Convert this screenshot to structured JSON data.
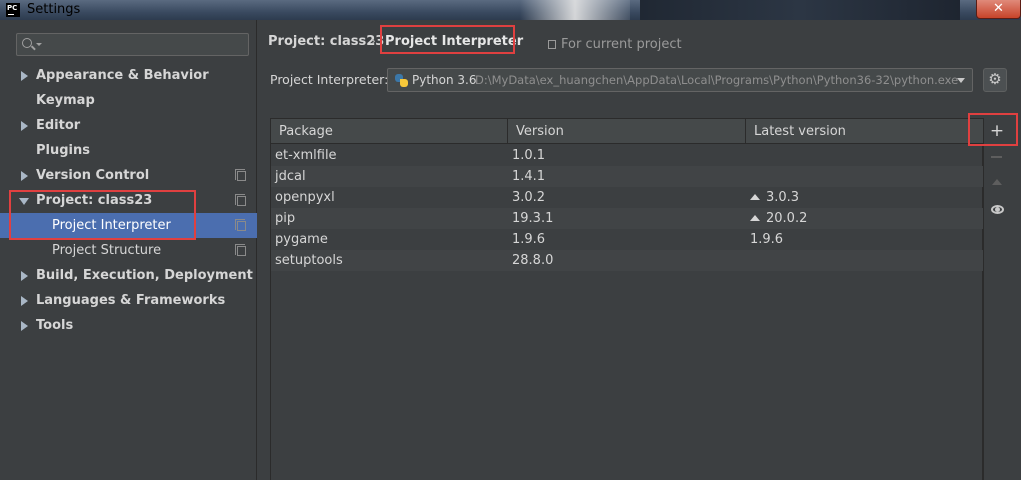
{
  "window": {
    "title": "Settings",
    "logo_text": "PC",
    "close_glyph": "✕"
  },
  "sidebar": {
    "search_placeholder": "",
    "items": [
      {
        "label": "Appearance & Behavior",
        "caret": "collapsed",
        "copy_icon": false
      },
      {
        "label": "Keymap",
        "caret": "none",
        "copy_icon": false
      },
      {
        "label": "Editor",
        "caret": "collapsed",
        "copy_icon": false
      },
      {
        "label": "Plugins",
        "caret": "none",
        "copy_icon": false
      },
      {
        "label": "Version Control",
        "caret": "collapsed",
        "copy_icon": true
      },
      {
        "label": "Project: class23",
        "caret": "expanded",
        "copy_icon": true
      },
      {
        "label": "Project Interpreter",
        "caret": "none",
        "copy_icon": true,
        "selected": true
      },
      {
        "label": "Project Structure",
        "caret": "none",
        "copy_icon": true
      },
      {
        "label": "Build, Execution, Deployment",
        "caret": "collapsed",
        "copy_icon": false
      },
      {
        "label": "Languages & Frameworks",
        "caret": "collapsed",
        "copy_icon": false
      },
      {
        "label": "Tools",
        "caret": "collapsed",
        "copy_icon": false
      }
    ]
  },
  "breadcrumb": {
    "project": "Project: class23",
    "separator": "›",
    "current": "Project Interpreter",
    "scope_note": "For current project"
  },
  "interpreter": {
    "label": "Project Interpreter:",
    "name": "Python 3.6",
    "path": "D:\\MyData\\ex_huangchen\\AppData\\Local\\Programs\\Python\\Python36-32\\python.exe",
    "settings_icon": "gear-icon"
  },
  "packages": {
    "columns": [
      "Package",
      "Version",
      "Latest version"
    ],
    "rows": [
      {
        "package": "et-xmlfile",
        "version": "1.0.1",
        "latest": "",
        "upgrade": false
      },
      {
        "package": "jdcal",
        "version": "1.4.1",
        "latest": "",
        "upgrade": false
      },
      {
        "package": "openpyxl",
        "version": "3.0.2",
        "latest": "3.0.3",
        "upgrade": true
      },
      {
        "package": "pip",
        "version": "19.3.1",
        "latest": "20.0.2",
        "upgrade": true
      },
      {
        "package": "pygame",
        "version": "1.9.6",
        "latest": "1.9.6",
        "upgrade": false
      },
      {
        "package": "setuptools",
        "version": "28.8.0",
        "latest": "",
        "upgrade": false
      }
    ]
  },
  "tools": {
    "add": "+",
    "remove_icon": "minus-icon",
    "upgrade_icon": "arrow-up-icon",
    "show_early_icon": "eye-icon"
  },
  "colors": {
    "selection": "#4b6eaf",
    "annotation_red": "#e04040",
    "background": "#3c3f41"
  }
}
